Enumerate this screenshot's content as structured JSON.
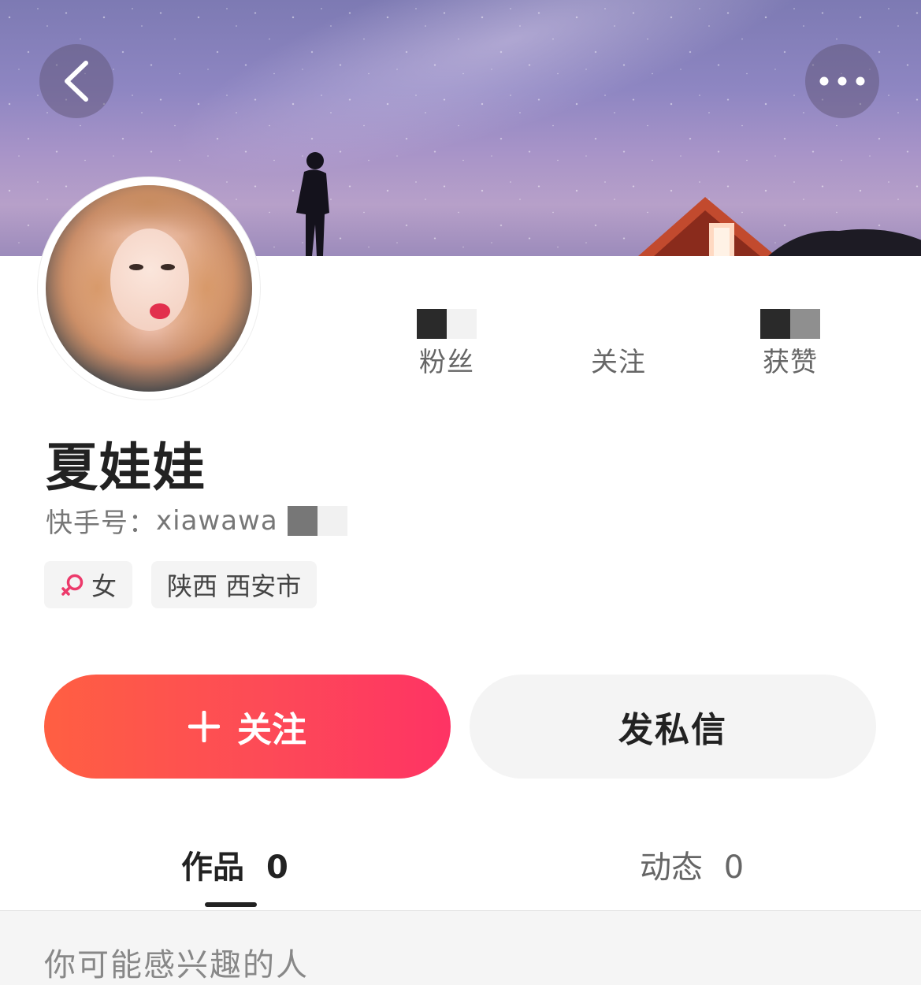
{
  "header": {
    "back_icon": "chevron-left-icon",
    "more_icon": "more-horizontal-icon"
  },
  "profile": {
    "name": "夏娃娃",
    "id_label": "快手号：",
    "id_value": "xiawawa",
    "gender": "女",
    "gender_icon": "female-icon",
    "location": "陕西 西安市"
  },
  "stats": [
    {
      "label": "粉丝"
    },
    {
      "label": "关注"
    },
    {
      "label": "获赞"
    }
  ],
  "actions": {
    "follow_label": "关注",
    "message_label": "发私信"
  },
  "tabs": {
    "works_label": "作品",
    "works_count": "0",
    "moments_label": "动态",
    "moments_count": "0"
  },
  "recommend": {
    "title": "你可能感兴趣的人"
  },
  "colors": {
    "follow_gradient_start": "#ff5f42",
    "follow_gradient_end": "#fe3364",
    "female_accent": "#ec3a6b"
  }
}
